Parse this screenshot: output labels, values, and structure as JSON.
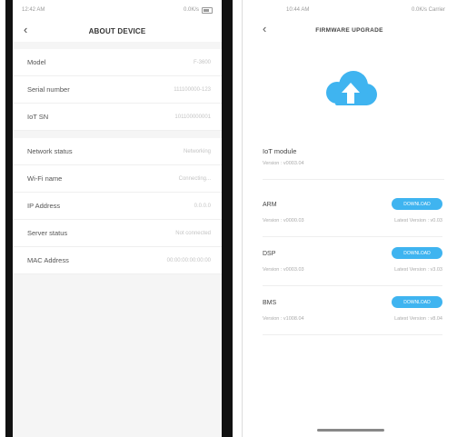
{
  "left": {
    "status": {
      "time": "12:42 AM",
      "right": "0.0K/s"
    },
    "nav": {
      "back": "‹",
      "title": "ABOUT DEVICE"
    },
    "group1": [
      {
        "label": "Model",
        "value": "F-3600"
      },
      {
        "label": "Serial number",
        "value": "111100000-123"
      },
      {
        "label": "IoT SN",
        "value": "101100000001"
      }
    ],
    "group2": [
      {
        "label": "Network status",
        "value": "Networking"
      },
      {
        "label": "Wi-Fi name",
        "value": "Connecting..."
      },
      {
        "label": "IP Address",
        "value": "0.0.0.0"
      },
      {
        "label": "Server status",
        "value": "Not connected"
      },
      {
        "label": "MAC Address",
        "value": "00:00:00:00:00:00"
      }
    ]
  },
  "right": {
    "status": {
      "time": "10:44 AM",
      "right": "0.0K/s Carrier"
    },
    "nav": {
      "back": "‹",
      "title": "FIRMWARE UPGRADE"
    },
    "accent_color": "#3fb4f0",
    "iot": {
      "name": "IoT module",
      "version": "Version : v0003.04"
    },
    "items": [
      {
        "name": "ARM",
        "version": "Version : v0000.03",
        "latest": "Latest Version : v0.03",
        "button": "DOWNLOAD"
      },
      {
        "name": "DSP",
        "version": "Version : v0003.03",
        "latest": "Latest Version : v3.03",
        "button": "DOWNLOAD"
      },
      {
        "name": "BMS",
        "version": "Version : v1008.04",
        "latest": "Latest Version : v8.04",
        "button": "DOWNLOAD"
      }
    ]
  }
}
